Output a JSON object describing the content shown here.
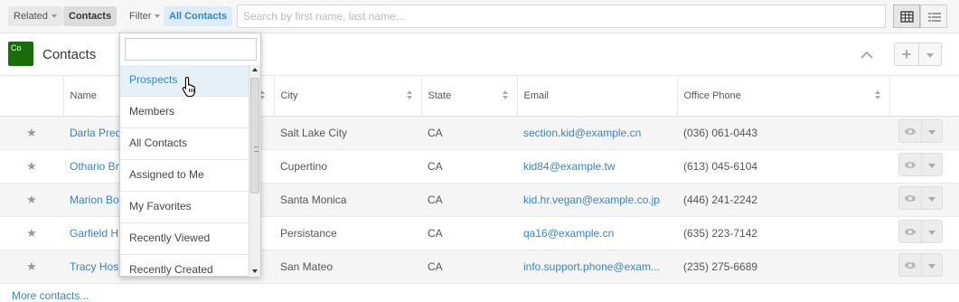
{
  "topbar": {
    "related_label": "Related",
    "module_chip": "Contacts",
    "filter_label": "Filter",
    "filter_value": "All Contacts",
    "search_placeholder": "Search by first name, last name..."
  },
  "header": {
    "module_icon_text": "Co",
    "title": "Contacts"
  },
  "table": {
    "columns": [
      "Name",
      "City",
      "State",
      "Email",
      "Office Phone"
    ],
    "rows": [
      {
        "name": "Darla Pred",
        "city": "Salt Lake City",
        "state": "CA",
        "email": "section.kid@example.cn",
        "phone": "(036) 061-0443"
      },
      {
        "name": "Othario Br",
        "city": "Cupertino",
        "state": "CA",
        "email": "kid84@example.tw",
        "phone": "(613) 045-6104"
      },
      {
        "name": "Marion Bo",
        "city": "Santa Monica",
        "state": "CA",
        "email": "kid.hr.vegan@example.co.jp",
        "phone": "(446) 241-2242"
      },
      {
        "name": "Garfield H",
        "city": "Persistance",
        "state": "CA",
        "email": "qa16@example.cn",
        "phone": "(635) 223-7142"
      },
      {
        "name": "Tracy Hos",
        "city": "San Mateo",
        "state": "CA",
        "email": "info.support.phone@exam...",
        "phone": "(235) 275-6689"
      }
    ]
  },
  "more_link": "More contacts...",
  "filter_dropdown": {
    "search_value": "",
    "items": [
      "Prospects",
      "Members",
      "All Contacts",
      "Assigned to Me",
      "My Favorites",
      "Recently Viewed",
      "Recently Created"
    ],
    "selected_index": 0
  },
  "colors": {
    "link": "#3a84c1",
    "module_icon": "#1a6b0c"
  }
}
